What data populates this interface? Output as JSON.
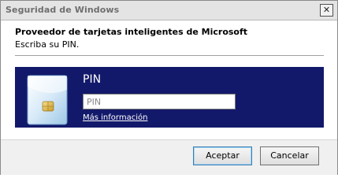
{
  "window": {
    "title": "Seguridad de Windows",
    "close_glyph": "✕"
  },
  "header": {
    "title": "Proveedor de tarjetas inteligentes de Microsoft",
    "subtitle": "Escriba su PIN."
  },
  "credential_tile": {
    "label": "PIN",
    "pin_placeholder": "PIN",
    "pin_value": "",
    "more_info_link": "Más información",
    "icon": "smart-card-icon",
    "background_color": "#13196a"
  },
  "buttons": {
    "ok": "Aceptar",
    "cancel": "Cancelar"
  }
}
